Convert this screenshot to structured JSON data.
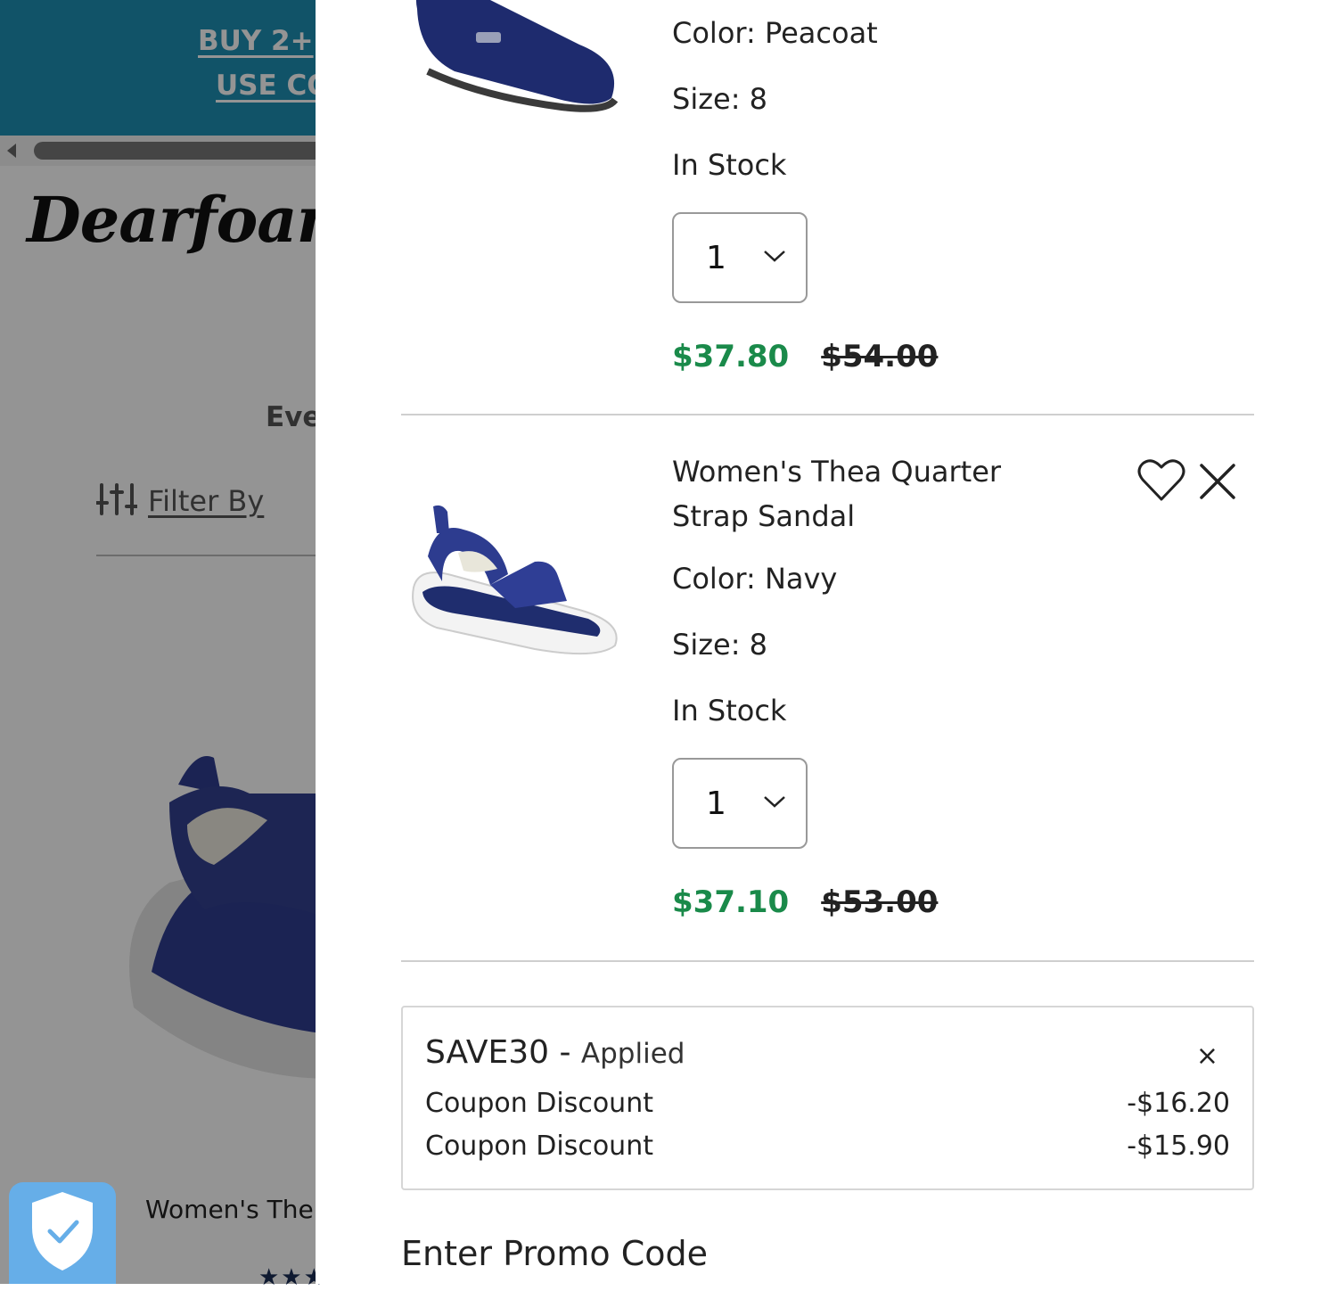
{
  "background": {
    "banner": {
      "line1": "BUY 2+ ",
      "line2": "USE CO"
    },
    "logo": "Dearfoams",
    "section_heading": "Eve",
    "filter_label": "Filter By",
    "product_name": "Women's The",
    "stars": "★★★"
  },
  "cart": {
    "items": [
      {
        "name": "",
        "color": "Color: Peacoat",
        "size": "Size: 8",
        "stock": "In Stock",
        "quantity": "1",
        "price_sale": "$37.80",
        "price_original": "$54.00"
      },
      {
        "name_line1": "Women's Thea Quarter",
        "name_line2": "Strap Sandal",
        "color": "Color: Navy",
        "size": "Size: 8",
        "stock": "In Stock",
        "quantity": "1",
        "price_sale": "$37.10",
        "price_original": "$53.00"
      }
    ],
    "coupon": {
      "code": "SAVE30",
      "separator": " - ",
      "status": "Applied",
      "remove": "×",
      "discounts": [
        {
          "label": "Coupon Discount",
          "amount": "-$16.20"
        },
        {
          "label": "Coupon Discount",
          "amount": "-$15.90"
        }
      ]
    },
    "promo_heading": "Enter Promo Code"
  },
  "colors": {
    "sale_price": "#1a8a4a",
    "banner": "#1e8fb4",
    "badge": "#66aee8"
  },
  "icons": {
    "wishlist": "heart-icon",
    "remove": "close-icon",
    "quantity": "chevron-down-icon",
    "filter": "sliders-icon",
    "security": "shield-check-icon"
  }
}
